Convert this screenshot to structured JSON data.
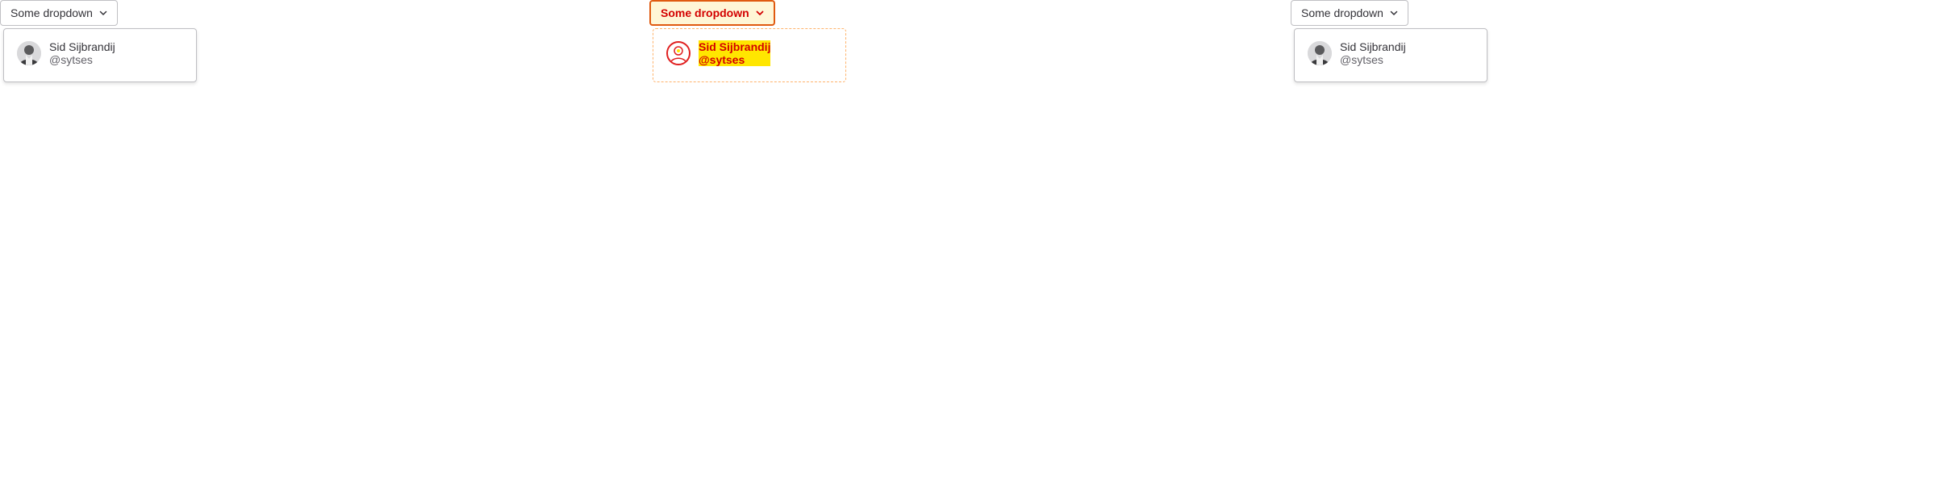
{
  "colors": {
    "text": "#333238",
    "secondary_text": "#626168",
    "border": "#bfbfc3",
    "diff_red": "#d30000",
    "diff_yellow": "#ffe600"
  },
  "panels": [
    {
      "dropdown": {
        "label": "Some dropdown",
        "icon": "chevron-down-icon"
      },
      "menu_item": {
        "name": "Sid Sijbrandij",
        "handle": "@sytses",
        "avatar_icon": "avatar"
      }
    },
    {
      "dropdown": {
        "label": "Some dropdown",
        "icon": "chevron-down-icon"
      },
      "menu_item": {
        "name": "Sid Sijbrandij",
        "handle": "@sytses",
        "avatar_icon": "avatar"
      }
    },
    {
      "dropdown": {
        "label": "Some dropdown",
        "icon": "chevron-down-icon"
      },
      "menu_item": {
        "name": "Sid Sijbrandij",
        "handle": "@sytses",
        "avatar_icon": "avatar"
      }
    }
  ]
}
